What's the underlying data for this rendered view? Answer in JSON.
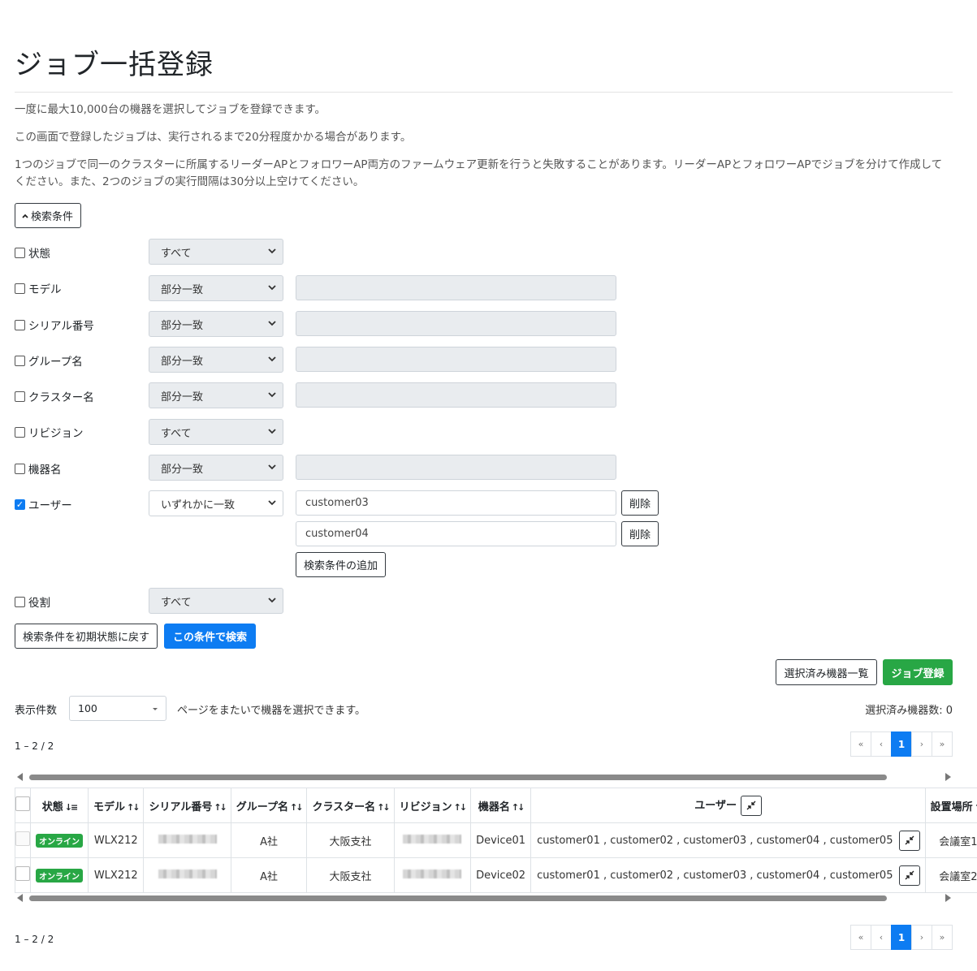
{
  "title": "ジョブ一括登録",
  "descriptions": [
    "一度に最大10,000台の機器を選択してジョブを登録できます。",
    "この画面で登録したジョブは、実行されるまで20分程度かかる場合があります。",
    "1つのジョブで同一のクラスターに所属するリーダーAPとフォロワーAP両方のファームウェア更新を行うと失敗することがあります。リーダーAPとフォロワーAPでジョブを分けて作成してください。また、2つのジョブの実行間隔は30分以上空けてください。"
  ],
  "search_toggle": {
    "icon": "chevron-up-icon",
    "label": "検索条件"
  },
  "conditions": {
    "state": {
      "label": "状態",
      "checked": false,
      "select": "すべて"
    },
    "model": {
      "label": "モデル",
      "checked": false,
      "select": "部分一致",
      "value": ""
    },
    "serial": {
      "label": "シリアル番号",
      "checked": false,
      "select": "部分一致",
      "value": ""
    },
    "group": {
      "label": "グループ名",
      "checked": false,
      "select": "部分一致",
      "value": ""
    },
    "cluster": {
      "label": "クラスター名",
      "checked": false,
      "select": "部分一致",
      "value": ""
    },
    "revision": {
      "label": "リビジョン",
      "checked": false,
      "select": "すべて"
    },
    "device": {
      "label": "機器名",
      "checked": false,
      "select": "部分一致",
      "value": ""
    },
    "user": {
      "label": "ユーザー",
      "checked": true,
      "select": "いずれかに一致",
      "values": [
        "customer03",
        "customer04"
      ],
      "delete_label": "削除",
      "add_label": "検索条件の追加"
    },
    "role": {
      "label": "役割",
      "checked": false,
      "select": "すべて"
    }
  },
  "actions": {
    "reset": "検索条件を初期状態に戻す",
    "search": "この条件で検索",
    "selected_list": "選択済み機器一覧",
    "register_job": "ジョブ登録"
  },
  "list_controls": {
    "per_page_label": "表示件数",
    "per_page_value": "100",
    "cross_page_note": "ページをまたいで機器を選択できます。",
    "selected_count": "選択済み機器数: 0",
    "range_text": "1 – 2 / 2"
  },
  "pagination": {
    "first": "«",
    "prev": "‹",
    "current": "1",
    "next": "›",
    "last": "»"
  },
  "table": {
    "columns": [
      "状態",
      "モデル",
      "シリアル番号",
      "グループ名",
      "クラスター名",
      "リビジョン",
      "機器名",
      "ユーザー",
      "設置場所"
    ],
    "rows": [
      {
        "status": "オンライン",
        "model": "WLX212",
        "group": "A社",
        "cluster": "大阪支社",
        "device": "Device01",
        "users": "customer01 , customer02 , customer03 , customer04 , customer05",
        "location": "会議室1"
      },
      {
        "status": "オンライン",
        "model": "WLX212",
        "group": "A社",
        "cluster": "大阪支社",
        "device": "Device02",
        "users": "customer01 , customer02 , customer03 , customer04 , customer05",
        "location": "会議室2"
      }
    ]
  },
  "colors": {
    "primary": "#0d7cf2",
    "success": "#28a745",
    "disabled_bg": "#e9ecef"
  }
}
